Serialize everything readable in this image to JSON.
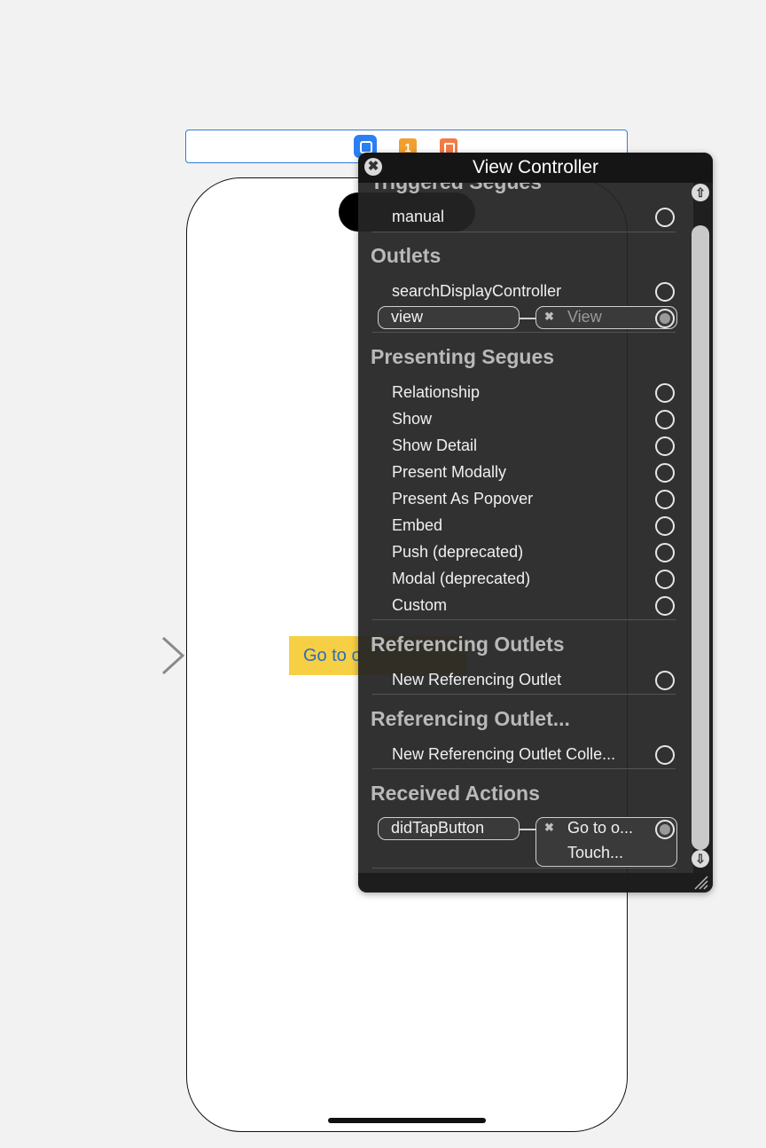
{
  "dock": {
    "first_responder_badge": "1"
  },
  "canvas": {
    "button_label": "Go to o"
  },
  "hud": {
    "title": "View Controller",
    "close_glyph": "✖",
    "sections": {
      "triggered_segues": {
        "title": "Triggered Segues",
        "rows": [
          "manual"
        ]
      },
      "outlets": {
        "title": "Outlets",
        "rows": [
          "searchDisplayController",
          "view"
        ]
      },
      "outlet_connection": {
        "source": "view",
        "target": "View"
      },
      "presenting_segues": {
        "title": "Presenting Segues",
        "rows": [
          "Relationship",
          "Show",
          "Show Detail",
          "Present Modally",
          "Present As Popover",
          "Embed",
          "Push (deprecated)",
          "Modal (deprecated)",
          "Custom"
        ]
      },
      "referencing_outlets": {
        "title": "Referencing Outlets",
        "rows": [
          "New Referencing Outlet"
        ]
      },
      "referencing_outlet_collections": {
        "title": "Referencing Outlet...",
        "rows": [
          "New Referencing Outlet Colle..."
        ]
      },
      "received_actions": {
        "title": "Received Actions",
        "source": "didTapButton",
        "target_line1": "Go to o...",
        "target_line2": "Touch..."
      }
    },
    "scroll_up_glyph": "⇧",
    "scroll_down_glyph": "⇩"
  },
  "colors": {
    "accent_blue": "#2b7ff5",
    "button_yellow": "#f6cf45",
    "hud_bg": "#242424"
  }
}
